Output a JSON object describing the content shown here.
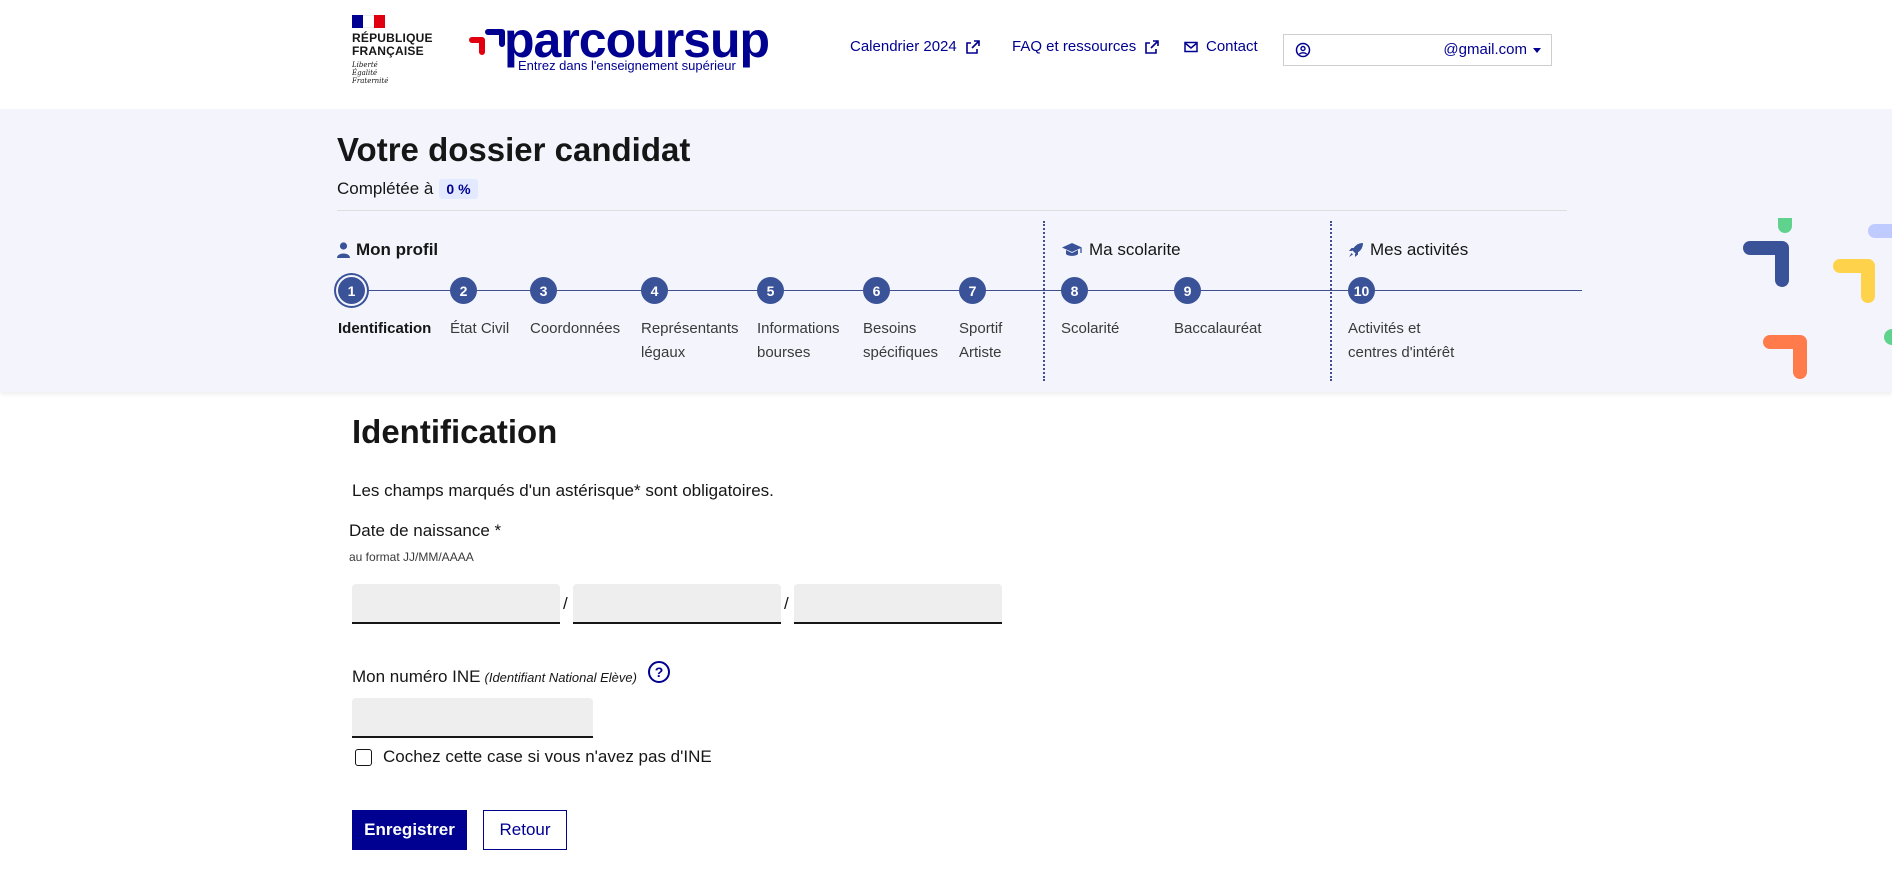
{
  "header": {
    "marianne": {
      "line1": "RÉPUBLIQUE",
      "line2": "FRANÇAISE",
      "devise1": "Liberté",
      "devise2": "Égalité",
      "devise3": "Fraternité"
    },
    "logo": {
      "word": "parcoursup",
      "tagline": "Entrez dans l'enseignement supérieur"
    },
    "nav": {
      "calendar": "Calendrier 2024",
      "faq": "FAQ et ressources",
      "contact": "Contact"
    },
    "account": {
      "email": "@gmail.com"
    }
  },
  "dossier": {
    "title": "Votre dossier candidat",
    "completion_label": "Complétée à",
    "completion_value": "0 %",
    "sections": {
      "profil": "Mon profil",
      "scolarite": "Ma scolarite",
      "activites": "Mes activités"
    },
    "steps": [
      {
        "num": "1",
        "line1": "Identification",
        "line2": ""
      },
      {
        "num": "2",
        "line1": "État Civil",
        "line2": ""
      },
      {
        "num": "3",
        "line1": "Coordonnées",
        "line2": ""
      },
      {
        "num": "4",
        "line1": "Représentants",
        "line2": "légaux"
      },
      {
        "num": "5",
        "line1": "Informations",
        "line2": "bourses"
      },
      {
        "num": "6",
        "line1": "Besoins",
        "line2": "spécifiques"
      },
      {
        "num": "7",
        "line1": "Sportif",
        "line2": "Artiste"
      },
      {
        "num": "8",
        "line1": "Scolarité",
        "line2": ""
      },
      {
        "num": "9",
        "line1": "Baccalauréat",
        "line2": ""
      },
      {
        "num": "10",
        "line1": "Activités et",
        "line2": "centres d'intérêt"
      }
    ]
  },
  "form": {
    "title": "Identification",
    "required_note": "Les champs marqués d'un astérisque* sont obligatoires.",
    "birthdate": {
      "label": "Date de naissance *",
      "hint": "au format JJ/MM/AAAA",
      "day_value": "",
      "month_value": "",
      "year_value": "",
      "separator": "/"
    },
    "ine": {
      "label": "Mon numéro INE",
      "sublabel": "(Identifiant National Elève)",
      "help": "?",
      "value": ""
    },
    "no_ine_checkbox": {
      "label": "Cochez cette case si vous n'avez pas d'INE",
      "checked": false
    },
    "buttons": {
      "save": "Enregistrer",
      "back": "Retour"
    }
  },
  "colors": {
    "primary": "#000091",
    "step": "#3a5298",
    "band_bg": "#f4f5fc",
    "marianne_red": "#e1000f"
  }
}
